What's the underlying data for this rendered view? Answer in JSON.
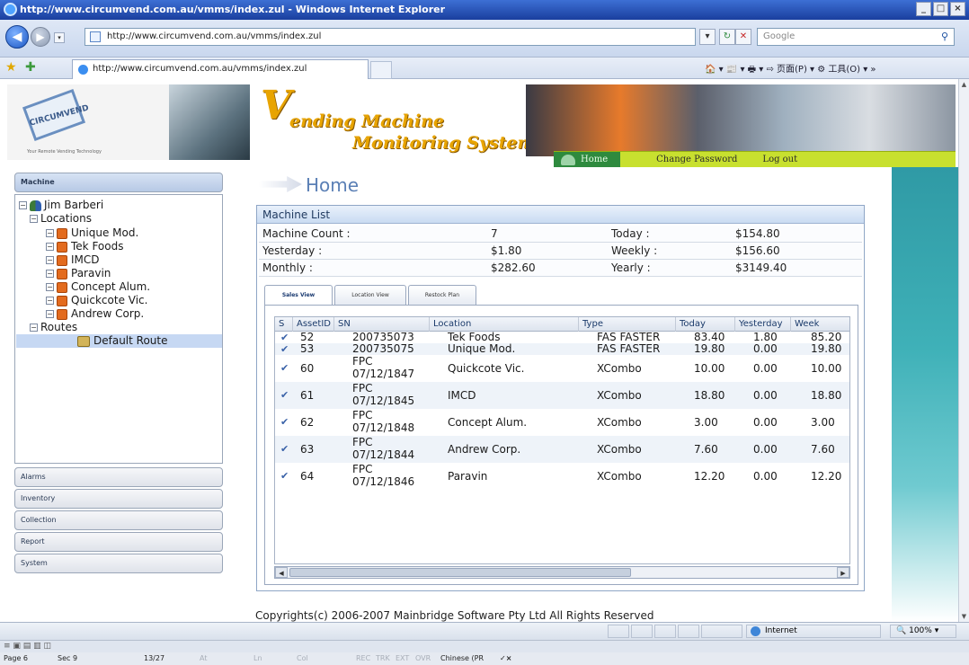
{
  "window": {
    "title": "http://www.circumvend.com.au/vmms/index.zul - Windows Internet Explorer",
    "controls": [
      "_",
      "□",
      "×"
    ]
  },
  "browser": {
    "address": "http://www.circumvend.com.au/vmms/index.zul",
    "search_placeholder": "Google",
    "tab_title": "http://www.circumvend.com.au/vmms/index.zul",
    "command_bar": "🏠 ▾ 📰 ▾ 🖶 ▾ ⇨ 页面(P) ▾ ⚙ 工具(O) ▾ »"
  },
  "banner": {
    "logo_text": "CIRCUMVEND",
    "logo_tagline": "Your Remote Vending Technology",
    "title_v": "V",
    "title_line1": "ending Machine",
    "title_line2": "Monitoring System",
    "menu": {
      "home": "Home",
      "change_password": "Change Password",
      "logout": "Log out"
    }
  },
  "sidebar": {
    "machine_header": "Machine",
    "tree": {
      "user": "Jim Barberi",
      "locations_label": "Locations",
      "locations": [
        "Unique Mod.",
        "Tek Foods",
        "IMCD",
        "Paravin",
        "Concept Alum.",
        "Quickcote Vic.",
        "Andrew Corp."
      ],
      "routes_label": "Routes",
      "routes": [
        "Default Route"
      ]
    },
    "sections": [
      "Alarms",
      "Inventory",
      "Collection",
      "Report",
      "System"
    ]
  },
  "main": {
    "page_title": "Home",
    "panel_title": "Machine List",
    "stats": {
      "machine_count_label": "Machine Count :",
      "machine_count": "7",
      "today_label": "Today :",
      "today": "$154.80",
      "yesterday_label": "Yesterday :",
      "yesterday": "$1.80",
      "weekly_label": "Weekly :",
      "weekly": "$156.60",
      "monthly_label": "Monthly :",
      "monthly": "$282.60",
      "yearly_label": "Yearly :",
      "yearly": "$3149.40"
    },
    "tabs": [
      "Sales View",
      "Location View",
      "Restock Plan"
    ],
    "grid": {
      "columns": [
        "S",
        "AssetID",
        "SN",
        "Location",
        "Type",
        "Today",
        "Yesterday",
        "Week"
      ],
      "rows": [
        {
          "status": "✔",
          "asset_id": "52",
          "sn1": "200735073",
          "sn2": "",
          "location": "Tek Foods",
          "type": "FAS FASTER",
          "today": "83.40",
          "yesterday": "1.80",
          "week": "85.20"
        },
        {
          "status": "✔",
          "asset_id": "53",
          "sn1": "200735075",
          "sn2": "",
          "location": "Unique Mod.",
          "type": "FAS FASTER",
          "today": "19.80",
          "yesterday": "0.00",
          "week": "19.80"
        },
        {
          "status": "✔",
          "asset_id": "60",
          "sn1": "FPC",
          "sn2": "07/12/1847",
          "location": "Quickcote Vic.",
          "type": "XCombo",
          "today": "10.00",
          "yesterday": "0.00",
          "week": "10.00"
        },
        {
          "status": "✔",
          "asset_id": "61",
          "sn1": "FPC",
          "sn2": "07/12/1845",
          "location": "IMCD",
          "type": "XCombo",
          "today": "18.80",
          "yesterday": "0.00",
          "week": "18.80"
        },
        {
          "status": "✔",
          "asset_id": "62",
          "sn1": "FPC",
          "sn2": "07/12/1848",
          "location": "Concept Alum.",
          "type": "XCombo",
          "today": "3.00",
          "yesterday": "0.00",
          "week": "3.00"
        },
        {
          "status": "✔",
          "asset_id": "63",
          "sn1": "FPC",
          "sn2": "07/12/1844",
          "location": "Andrew Corp.",
          "type": "XCombo",
          "today": "7.60",
          "yesterday": "0.00",
          "week": "7.60"
        },
        {
          "status": "✔",
          "asset_id": "64",
          "sn1": "FPC",
          "sn2": "07/12/1846",
          "location": "Paravin",
          "type": "XCombo",
          "today": "12.20",
          "yesterday": "0.00",
          "week": "12.20"
        }
      ]
    },
    "copyright": "Copyrights(c) 2006-2007 Mainbridge Software Pty Ltd All Rights Reserved"
  },
  "statusbar": {
    "zone": "Internet",
    "zoom": "100%"
  },
  "word_status": {
    "page": "Page 6",
    "sec": "Sec 9",
    "pages": "13/27",
    "at": "At",
    "ln": "Ln",
    "col": "Col",
    "rec": "REC",
    "trk": "TRK",
    "ext": "EXT",
    "ovr": "OVR",
    "language": "Chinese (PR",
    "check": "✓×"
  },
  "colors": {
    "accent_blue": "#5a7fb5",
    "menu_green": "#c8e02f",
    "home_green": "#2e8a3e",
    "title_orange": "#e8a400"
  }
}
